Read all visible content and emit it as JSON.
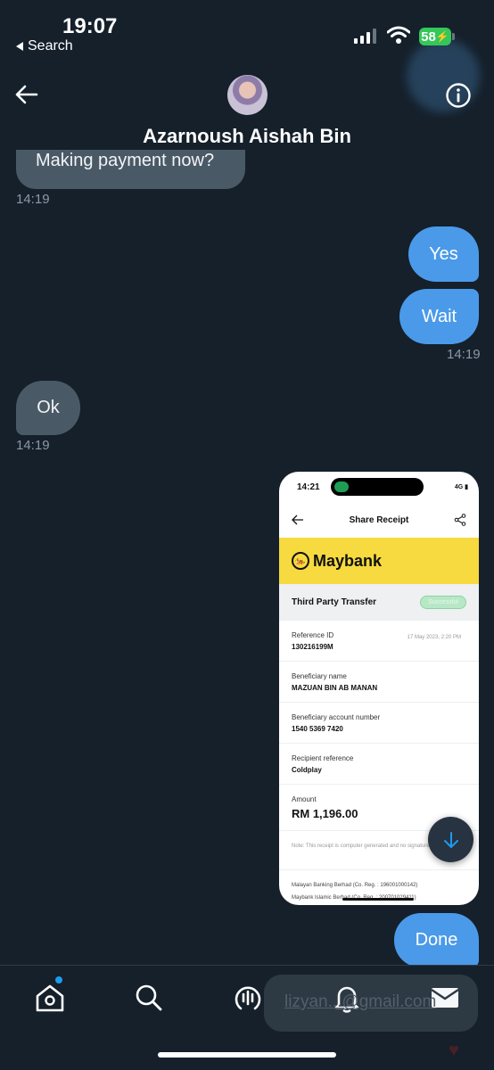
{
  "status_bar": {
    "time": "19:07",
    "back_label": "Search",
    "battery": "58"
  },
  "header": {
    "title": "Azarnoush Aishah Bin"
  },
  "messages": [
    {
      "text": "Making payment now?",
      "time": "14:19",
      "from": "them"
    },
    {
      "text": "Yes",
      "from": "me"
    },
    {
      "text": "Wait",
      "time": "14:19",
      "from": "me"
    },
    {
      "text": "Ok",
      "time": "14:19",
      "from": "them"
    },
    {
      "text": "Done",
      "from": "me"
    }
  ],
  "receipt": {
    "phone_time": "14:21",
    "network": "4G",
    "screen_title": "Share Receipt",
    "brand": "Maybank",
    "transfer_type": "Third Party Transfer",
    "status": "Successful",
    "reference_label": "Reference ID",
    "reference_value": "130216199M",
    "date": "17 May 2023, 2:20 PM",
    "beneficiary_label": "Beneficiary name",
    "beneficiary_value": "MAZUAN BIN AB MANAN",
    "account_label": "Beneficiary account number",
    "account_value": "1540 5369 7420",
    "recipient_ref_label": "Recipient reference",
    "recipient_ref_value": "Coldplay",
    "amount_label": "Amount",
    "amount_value": "RM 1,196.00",
    "note": "Note: This receipt is computer generated and no signature is required.",
    "footer_1": "Malayan Banking Berhad (Co. Reg. : 196001000142)",
    "footer_2": "Maybank Islamic Berhad (Co. Reg. : 200701029411)"
  },
  "overlay_text": "lizyan...@gmail.com",
  "nav": [
    "home-icon",
    "search-icon",
    "spaces-icon",
    "bell-icon",
    "mail-icon"
  ],
  "colors": {
    "background": "#15202b",
    "incoming": "#4a5966",
    "outgoing": "#4a9ae9",
    "maybank_yellow": "#f6da3f"
  }
}
